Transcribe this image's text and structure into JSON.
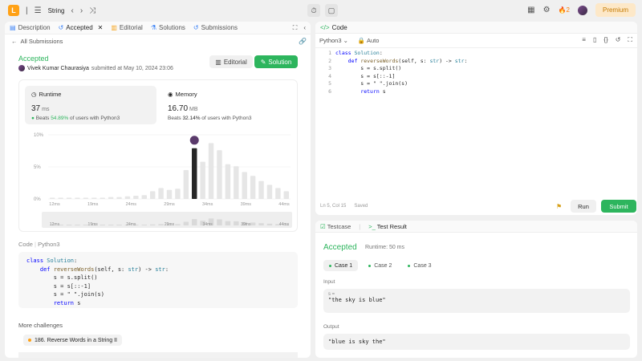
{
  "topbar": {
    "logo": "L",
    "problem_list_label": "String",
    "streak_count": "2",
    "premium_label": "Premium"
  },
  "left_tabs": [
    {
      "label": "Description"
    },
    {
      "label": "Accepted"
    },
    {
      "label": "Editorial"
    },
    {
      "label": "Solutions"
    },
    {
      "label": "Submissions"
    }
  ],
  "submission": {
    "back_label": "All Submissions",
    "status": "Accepted",
    "author": "Vivek Kumar Chaurasiya",
    "submitted_text": "submitted at May 10, 2024 23:06",
    "editorial_label": "Editorial",
    "solution_label": "Solution"
  },
  "runtime": {
    "title": "Runtime",
    "value": "37",
    "unit": "ms",
    "beats_prefix": "Beats",
    "beats_pct": "54.89%",
    "beats_suffix": "of users with Python3"
  },
  "memory": {
    "title": "Memory",
    "value": "16.70",
    "unit": "MB",
    "beats_prefix": "Beats",
    "beats_pct": "32.14%",
    "beats_suffix": "of users with Python3"
  },
  "chart_data": {
    "type": "bar",
    "ylabels": [
      "10%",
      "5%",
      "0%"
    ],
    "ylim": [
      0,
      10
    ],
    "x_tick_labels": [
      "12ms",
      "19ms",
      "24ms",
      "29ms",
      "34ms",
      "39ms",
      "44ms"
    ],
    "mini_tick_labels": [
      "12ms",
      "19ms",
      "24ms",
      "29ms",
      "34ms",
      "39ms",
      "44ms"
    ],
    "highlight_index": 17,
    "values": [
      0.2,
      0.2,
      0.2,
      0.2,
      0.2,
      0.2,
      0.2,
      0.3,
      0.3,
      0.4,
      0.5,
      0.6,
      1.2,
      1.7,
      1.4,
      1.6,
      4.5,
      7.9,
      5.8,
      8.7,
      7.6,
      5.4,
      5.1,
      4.2,
      3.6,
      2.8,
      2.2,
      1.7,
      1.2
    ]
  },
  "code_section": {
    "label": "Code",
    "lang": "Python3",
    "lines": [
      "class Solution:",
      "    def reverseWords(self, s: str) -> str:",
      "        s = s.split()",
      "        s = s[::-1]",
      "        s = \" \".join(s)",
      "        return s"
    ]
  },
  "more": {
    "title": "More challenges",
    "items": [
      "186. Reverse Words in a String II"
    ]
  },
  "editor": {
    "tab_label": "Code",
    "language": "Python3",
    "auto_label": "Auto",
    "line_numbers": [
      "1",
      "2",
      "3",
      "4",
      "5",
      "6"
    ],
    "position": "Ln 5, Col 15",
    "saved": "Saved",
    "run_label": "Run",
    "submit_label": "Submit"
  },
  "result": {
    "testcase_tab": "Testcase",
    "testresult_tab": "Test Result",
    "status": "Accepted",
    "runtime": "Runtime: 50 ms",
    "cases": [
      "Case 1",
      "Case 2",
      "Case 3"
    ],
    "input_label": "Input",
    "input_var": "s =",
    "input_value": "\"the sky is blue\"",
    "output_label": "Output",
    "output_value": "\"blue is sky the\""
  },
  "colors": {
    "accent_green": "#2db55d",
    "brand_orange": "#ffa116"
  }
}
